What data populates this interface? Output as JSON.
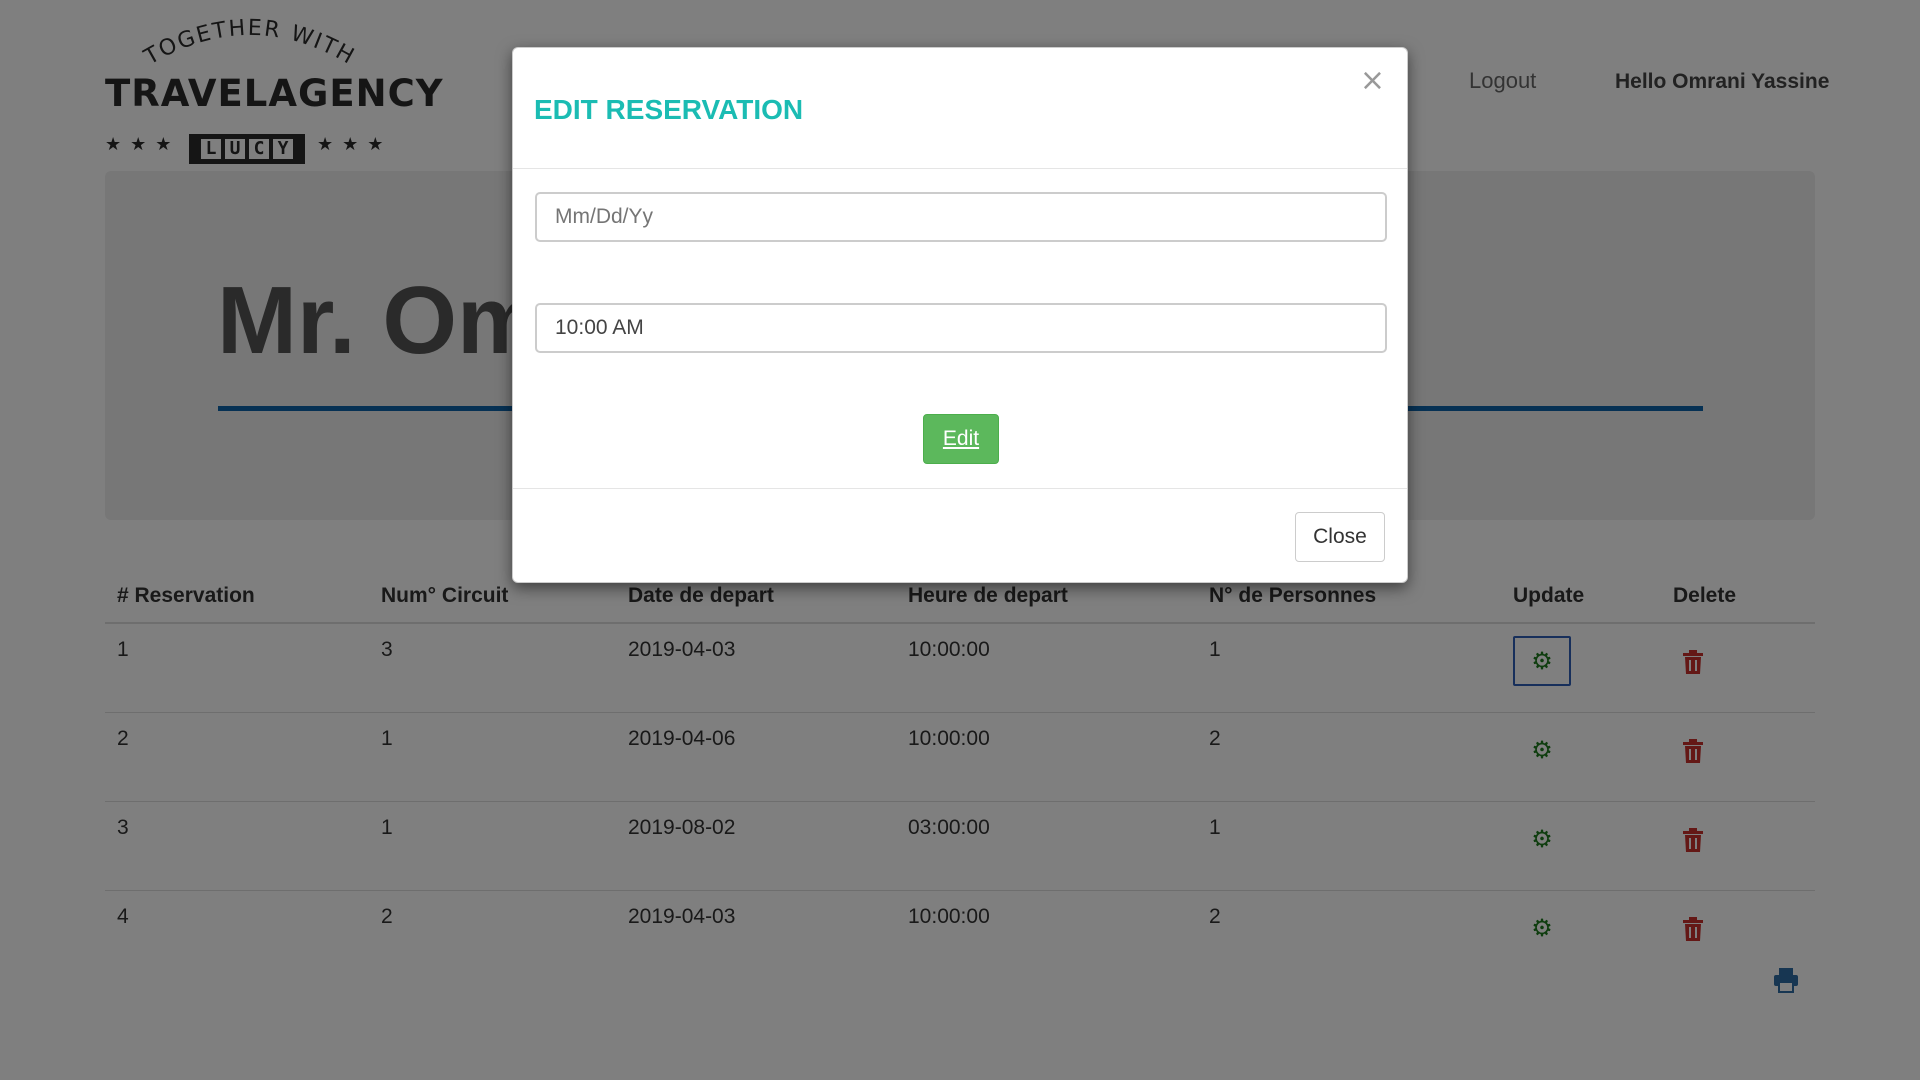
{
  "brand": {
    "tagline": "TOGETHER WITH",
    "name": "TRAVELAGENCY",
    "sub_letters": [
      "L",
      "U",
      "C",
      "Y"
    ]
  },
  "nav": {
    "logout_label": "Logout",
    "greeting": "Hello Omrani Yassine"
  },
  "jumbotron": {
    "name_visible": "Mr. Om"
  },
  "table": {
    "headers": [
      "# Reservation",
      "Num° Circuit",
      "Date de depart",
      "Heure de depart",
      "N° de Personnes",
      "Update",
      "Delete"
    ],
    "rows": [
      {
        "id": "1",
        "circuit": "3",
        "date": "2019-04-03",
        "time": "10:00:00",
        "persons": "1"
      },
      {
        "id": "2",
        "circuit": "1",
        "date": "2019-04-06",
        "time": "10:00:00",
        "persons": "2"
      },
      {
        "id": "3",
        "circuit": "1",
        "date": "2019-08-02",
        "time": "03:00:00",
        "persons": "1"
      },
      {
        "id": "4",
        "circuit": "2",
        "date": "2019-04-03",
        "time": "10:00:00",
        "persons": "2"
      }
    ],
    "update_icon": "gear-icon",
    "delete_icon": "trash-icon"
  },
  "print_icon": "printer-icon",
  "modal": {
    "title": "EDIT RESERVATION",
    "close_x": "×",
    "date_placeholder": "Mm/Dd/Yy",
    "time_value": "10:00 AM",
    "edit_label": "Edit",
    "close_label": "Close"
  },
  "colors": {
    "modal_title": "#1bbcb3",
    "edit_button": "#5cb85c",
    "gear_icon": "#1e7b1e",
    "trash_icon": "#c9302c",
    "print_icon": "#2e6da4",
    "jumbotron_rule": "#0d63a8"
  }
}
